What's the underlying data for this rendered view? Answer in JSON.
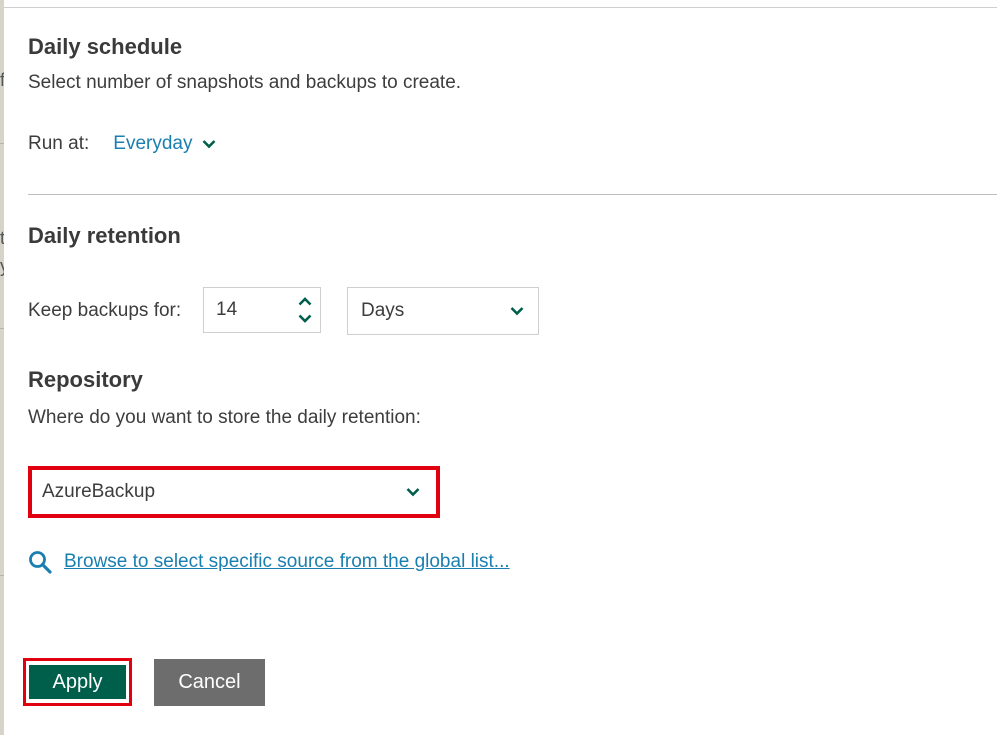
{
  "background_fragments": [
    "f",
    "t",
    "y"
  ],
  "daily_schedule": {
    "title": "Daily schedule",
    "description": "Select number of snapshots and backups to create.",
    "run_at_label": "Run at:",
    "run_at_value": "Everyday"
  },
  "daily_retention": {
    "title": "Daily retention",
    "keep_label": "Keep backups for:",
    "keep_value": "14",
    "unit_value": "Days"
  },
  "repository": {
    "title": "Repository",
    "question": "Where do you want to store the daily retention:",
    "selected": "AzureBackup",
    "browse_link": "Browse to select specific source from the global list..."
  },
  "actions": {
    "apply_label": "Apply",
    "cancel_label": "Cancel"
  },
  "colors": {
    "link": "#1a7fb0",
    "chevron": "#005f4b",
    "apply_bg": "#005f4b",
    "cancel_bg": "#6d6d6d",
    "highlight": "#e0000f"
  },
  "icons": {
    "dropdown": "chevron-down-icon",
    "spinner_up": "chevron-up-icon",
    "spinner_down": "chevron-down-icon",
    "browse": "search-icon"
  }
}
